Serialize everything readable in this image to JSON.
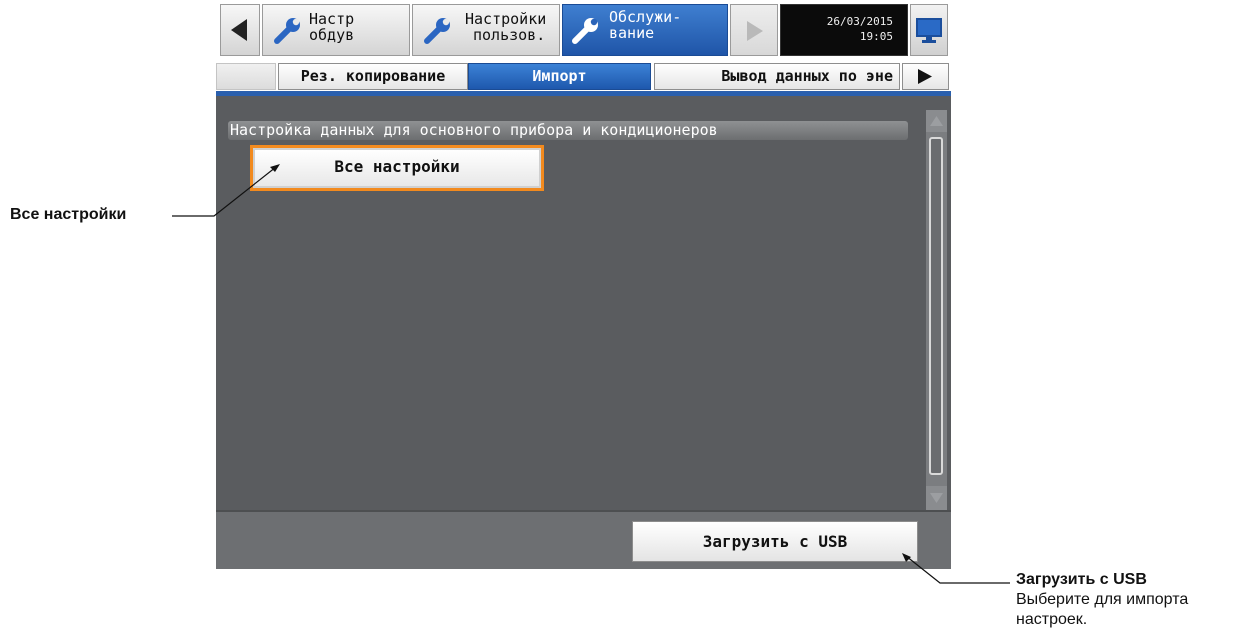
{
  "topbar": {
    "items": [
      {
        "label_line1": "Настр",
        "label_line2": "обдув",
        "icon": "wrench-icon"
      },
      {
        "label_line1": "Настройки",
        "label_line2": "пользов.",
        "icon": "wrench-icon"
      },
      {
        "label_line1": "Обслужи-",
        "label_line2": "вание",
        "icon": "wrench-icon",
        "active": true
      }
    ],
    "date": "26/03/2015",
    "time": "19:05"
  },
  "tabs": {
    "items": [
      {
        "label": "Рез. копирование"
      },
      {
        "label": "Импорт",
        "active": true
      },
      {
        "label": "Вывод данных по эне"
      }
    ]
  },
  "main": {
    "section_title": "Настройка данных для основного прибора и кондиционеров",
    "all_settings_button": "Все настройки"
  },
  "bottom": {
    "load_usb_button": "Загрузить с USB"
  },
  "callouts": {
    "all_settings": "Все настройки",
    "load_usb_title": "Загрузить с USB",
    "load_usb_desc_line1": "Выберите для импорта",
    "load_usb_desc_line2": "настроек."
  },
  "colors": {
    "active_blue": "#1f55a8",
    "highlight_orange": "#f28a1e",
    "screen_gray": "#5a5c5f"
  }
}
